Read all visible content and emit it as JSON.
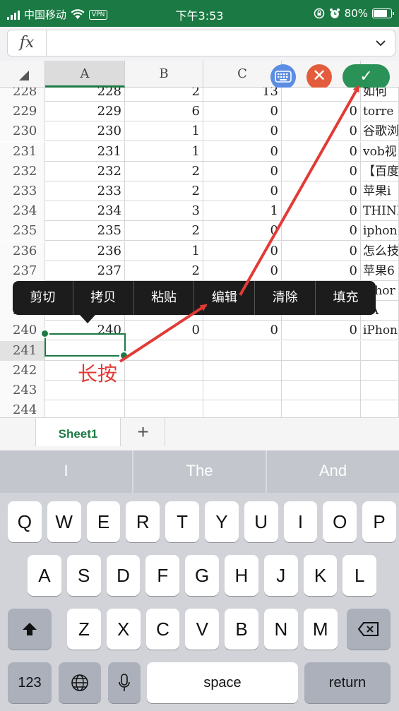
{
  "status_bar": {
    "carrier": "中国移动",
    "vpn": "VPN",
    "time": "下午3:53",
    "battery": "80%",
    "battery_level": 0.8
  },
  "formula_bar": {
    "fx_label": "fx",
    "value": ""
  },
  "columns": [
    "A",
    "B",
    "C"
  ],
  "toolbar": {
    "cancel_label": "✕",
    "confirm_label": "✓"
  },
  "rows": [
    {
      "n": "228",
      "a": "228",
      "b": "2",
      "c": "13",
      "d": "",
      "e": "如何"
    },
    {
      "n": "229",
      "a": "229",
      "b": "6",
      "c": "0",
      "d": "0",
      "e": "torre"
    },
    {
      "n": "230",
      "a": "230",
      "b": "1",
      "c": "0",
      "d": "0",
      "e": "谷歌浏"
    },
    {
      "n": "231",
      "a": "231",
      "b": "1",
      "c": "0",
      "d": "0",
      "e": "vob视"
    },
    {
      "n": "232",
      "a": "232",
      "b": "2",
      "c": "0",
      "d": "0",
      "e": "【百度"
    },
    {
      "n": "233",
      "a": "233",
      "b": "2",
      "c": "0",
      "d": "0",
      "e": "苹果i"
    },
    {
      "n": "234",
      "a": "234",
      "b": "3",
      "c": "1",
      "d": "0",
      "e": "THINK"
    },
    {
      "n": "235",
      "a": "235",
      "b": "2",
      "c": "0",
      "d": "0",
      "e": "iphon"
    },
    {
      "n": "236",
      "a": "236",
      "b": "1",
      "c": "0",
      "d": "0",
      "e": "怎么技"
    },
    {
      "n": "237",
      "a": "237",
      "b": "2",
      "c": "0",
      "d": "0",
      "e": "苹果6"
    },
    {
      "n": "238",
      "a": "",
      "b": "",
      "c": "",
      "d": "",
      "e": "iphor"
    },
    {
      "n": "239",
      "a": "",
      "b": "",
      "c": "",
      "d": "",
      "e": "YA"
    },
    {
      "n": "240",
      "a": "240",
      "b": "0",
      "c": "0",
      "d": "0",
      "e": "iPhon"
    },
    {
      "n": "241",
      "a": "",
      "b": "",
      "c": "",
      "d": "",
      "e": ""
    },
    {
      "n": "242",
      "a": "",
      "b": "",
      "c": "",
      "d": "",
      "e": ""
    },
    {
      "n": "243",
      "a": "",
      "b": "",
      "c": "",
      "d": "",
      "e": ""
    },
    {
      "n": "244",
      "a": "",
      "b": "",
      "c": "",
      "d": "",
      "e": ""
    }
  ],
  "context_menu": [
    "剪切",
    "拷贝",
    "粘贴",
    "编辑",
    "清除",
    "填充"
  ],
  "annotation": {
    "label": "长按",
    "arrow_color": "#e23b36"
  },
  "sheets": {
    "tabs": [
      "Sheet1"
    ],
    "add_label": "+"
  },
  "keyboard": {
    "suggestions": [
      "I",
      "The",
      "And"
    ],
    "row1": [
      "Q",
      "W",
      "E",
      "R",
      "T",
      "Y",
      "U",
      "I",
      "O",
      "P"
    ],
    "row2": [
      "A",
      "S",
      "D",
      "F",
      "G",
      "H",
      "J",
      "K",
      "L"
    ],
    "row3": [
      "Z",
      "X",
      "C",
      "V",
      "B",
      "N",
      "M"
    ],
    "numbers_label": "123",
    "space_label": "space",
    "return_label": "return"
  },
  "colors": {
    "brand": "#1b7a43",
    "selection": "#1e7a45",
    "accent_red": "#e23b36"
  }
}
